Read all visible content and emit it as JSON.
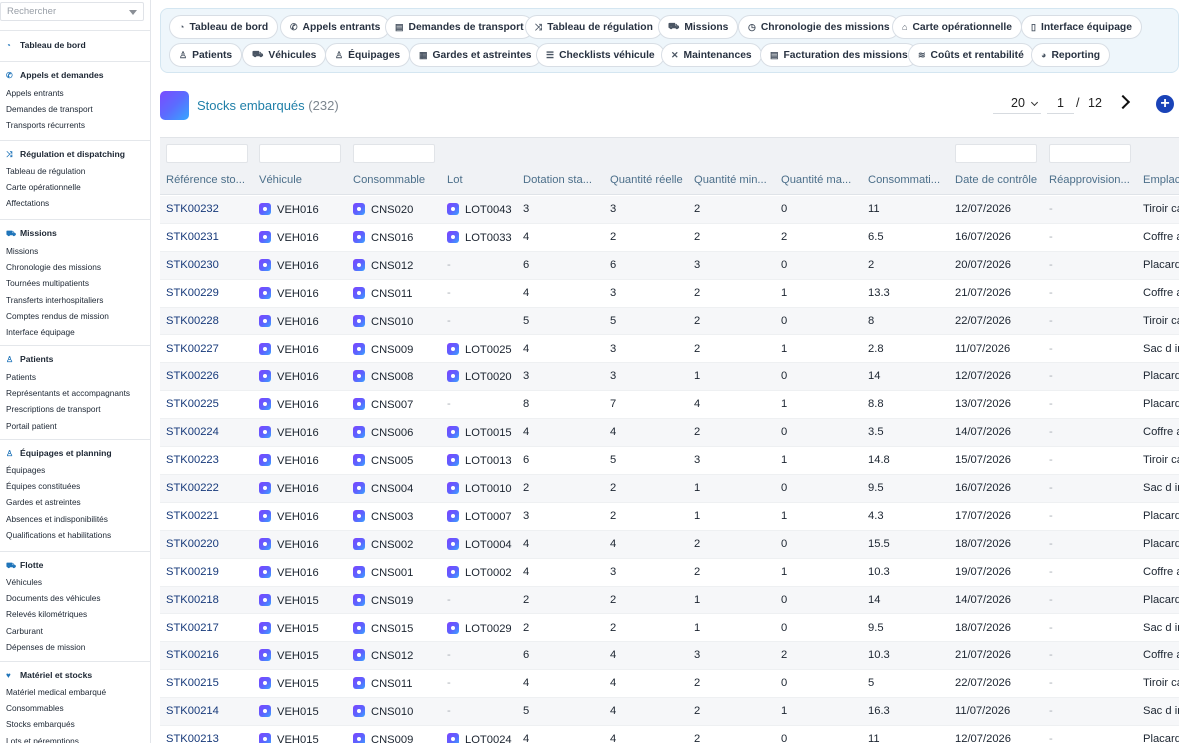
{
  "sidebar": {
    "search_placeholder": "Rechercher",
    "sections": [
      {
        "title": "Tableau de bord",
        "icon": "dashboard-icon",
        "items": []
      },
      {
        "title": "Appels et demandes",
        "icon": "phone-icon",
        "items": [
          "Appels entrants",
          "Demandes de transport",
          "Transports récurrents"
        ]
      },
      {
        "title": "Régulation et dispatching",
        "icon": "shuffle-icon",
        "items": [
          "Tableau de régulation",
          "Carte opérationnelle",
          "Affectations"
        ]
      },
      {
        "title": "Missions",
        "icon": "truck-icon",
        "items": [
          "Missions",
          "Chronologie des missions",
          "Tournées multipatients",
          "Transferts interhospitaliers",
          "Comptes rendus de mission",
          "Interface équipage"
        ]
      },
      {
        "title": "Patients",
        "icon": "person-icon",
        "items": [
          "Patients",
          "Représentants et accompagnants",
          "Prescriptions de transport",
          "Portail patient"
        ]
      },
      {
        "title": "Équipages et planning",
        "icon": "person-icon",
        "items": [
          "Équipages",
          "Équipes constituées",
          "Gardes et astreintes",
          "Absences et indisponibilités",
          "Qualifications et habilitations"
        ]
      },
      {
        "title": "Flotte",
        "icon": "truck-icon",
        "items": [
          "Véhicules",
          "Documents des véhicules",
          "Relevés kilométriques",
          "Carburant",
          "Dépenses de mission"
        ]
      },
      {
        "title": "Matériel et stocks",
        "icon": "heart-icon",
        "items": [
          "Matériel medical embarqué",
          "Consommables",
          "Stocks embarqués",
          "Lots et péremptions"
        ]
      }
    ]
  },
  "topnav": [
    {
      "label": "Tableau de bord",
      "icon": "dashboard-icon",
      "glyph": "◔"
    },
    {
      "label": "Appels entrants",
      "icon": "phone-icon",
      "glyph": "✆"
    },
    {
      "label": "Demandes de transport",
      "icon": "document-icon",
      "glyph": "▤"
    },
    {
      "label": "Tableau de régulation",
      "icon": "shuffle-icon",
      "glyph": "⤨"
    },
    {
      "label": "Missions",
      "icon": "truck-icon",
      "glyph": "⛟"
    },
    {
      "label": "Chronologie des missions",
      "icon": "stopwatch-icon",
      "glyph": "◷"
    },
    {
      "label": "Carte opérationnelle",
      "icon": "map-icon",
      "glyph": "⌂"
    },
    {
      "label": "Interface équipage",
      "icon": "mobile-icon",
      "glyph": "▯"
    },
    {
      "label": "Patients",
      "icon": "person-icon",
      "glyph": "♙"
    },
    {
      "label": "Véhicules",
      "icon": "truck-icon",
      "glyph": "⛟"
    },
    {
      "label": "Équipages",
      "icon": "person-icon",
      "glyph": "♙"
    },
    {
      "label": "Gardes et astreintes",
      "icon": "calendar-icon",
      "glyph": "▦"
    },
    {
      "label": "Checklists véhicule",
      "icon": "list-icon",
      "glyph": "☰"
    },
    {
      "label": "Maintenances",
      "icon": "tools-icon",
      "glyph": "✕"
    },
    {
      "label": "Facturation des missions",
      "icon": "invoice-icon",
      "glyph": "▤"
    },
    {
      "label": "Coûts et rentabilité",
      "icon": "coins-icon",
      "glyph": "≋"
    },
    {
      "label": "Reporting",
      "icon": "chart-icon",
      "glyph": "◕"
    }
  ],
  "header": {
    "title": "Stocks embarqués",
    "count": "(232)",
    "per_page": "20",
    "page": "1",
    "page_sep": "/",
    "total_pages": "12"
  },
  "table": {
    "columns": [
      "Référence sto...",
      "Véhicule",
      "Consommable",
      "Lot",
      "Dotation sta...",
      "Quantité réelle",
      "Quantité min...",
      "Quantité ma...",
      "Consommati...",
      "Date de contrôle",
      "Réapprovision...",
      "Emplac"
    ],
    "rows": [
      {
        "ref": "STK00232",
        "vehicle": "VEH016",
        "consumable": "CNS020",
        "lot": "LOT0043",
        "dotation": "3",
        "qty": "3",
        "min": "2",
        "max": "0",
        "conso": "11",
        "date": "12/07/2026",
        "reappro": "-",
        "place": "Tiroir ca"
      },
      {
        "ref": "STK00231",
        "vehicle": "VEH016",
        "consumable": "CNS016",
        "lot": "LOT0033",
        "dotation": "4",
        "qty": "2",
        "min": "2",
        "max": "2",
        "conso": "6.5",
        "date": "16/07/2026",
        "reappro": "-",
        "place": "Coffre a"
      },
      {
        "ref": "STK00230",
        "vehicle": "VEH016",
        "consumable": "CNS012",
        "lot": "-",
        "dotation": "6",
        "qty": "6",
        "min": "3",
        "max": "0",
        "conso": "2",
        "date": "20/07/2026",
        "reappro": "-",
        "place": "Placard"
      },
      {
        "ref": "STK00229",
        "vehicle": "VEH016",
        "consumable": "CNS011",
        "lot": "-",
        "dotation": "4",
        "qty": "3",
        "min": "2",
        "max": "1",
        "conso": "13.3",
        "date": "21/07/2026",
        "reappro": "-",
        "place": "Coffre a"
      },
      {
        "ref": "STK00228",
        "vehicle": "VEH016",
        "consumable": "CNS010",
        "lot": "-",
        "dotation": "5",
        "qty": "5",
        "min": "2",
        "max": "0",
        "conso": "8",
        "date": "22/07/2026",
        "reappro": "-",
        "place": "Tiroir ca"
      },
      {
        "ref": "STK00227",
        "vehicle": "VEH016",
        "consumable": "CNS009",
        "lot": "LOT0025",
        "dotation": "4",
        "qty": "3",
        "min": "2",
        "max": "1",
        "conso": "2.8",
        "date": "11/07/2026",
        "reappro": "-",
        "place": "Sac d ir"
      },
      {
        "ref": "STK00226",
        "vehicle": "VEH016",
        "consumable": "CNS008",
        "lot": "LOT0020",
        "dotation": "3",
        "qty": "3",
        "min": "1",
        "max": "0",
        "conso": "14",
        "date": "12/07/2026",
        "reappro": "-",
        "place": "Placard"
      },
      {
        "ref": "STK00225",
        "vehicle": "VEH016",
        "consumable": "CNS007",
        "lot": "-",
        "dotation": "8",
        "qty": "7",
        "min": "4",
        "max": "1",
        "conso": "8.8",
        "date": "13/07/2026",
        "reappro": "-",
        "place": "Placard"
      },
      {
        "ref": "STK00224",
        "vehicle": "VEH016",
        "consumable": "CNS006",
        "lot": "LOT0015",
        "dotation": "4",
        "qty": "4",
        "min": "2",
        "max": "0",
        "conso": "3.5",
        "date": "14/07/2026",
        "reappro": "-",
        "place": "Coffre a"
      },
      {
        "ref": "STK00223",
        "vehicle": "VEH016",
        "consumable": "CNS005",
        "lot": "LOT0013",
        "dotation": "6",
        "qty": "5",
        "min": "3",
        "max": "1",
        "conso": "14.8",
        "date": "15/07/2026",
        "reappro": "-",
        "place": "Tiroir ca"
      },
      {
        "ref": "STK00222",
        "vehicle": "VEH016",
        "consumable": "CNS004",
        "lot": "LOT0010",
        "dotation": "2",
        "qty": "2",
        "min": "1",
        "max": "0",
        "conso": "9.5",
        "date": "16/07/2026",
        "reappro": "-",
        "place": "Sac d ir"
      },
      {
        "ref": "STK00221",
        "vehicle": "VEH016",
        "consumable": "CNS003",
        "lot": "LOT0007",
        "dotation": "3",
        "qty": "2",
        "min": "1",
        "max": "1",
        "conso": "4.3",
        "date": "17/07/2026",
        "reappro": "-",
        "place": "Placard"
      },
      {
        "ref": "STK00220",
        "vehicle": "VEH016",
        "consumable": "CNS002",
        "lot": "LOT0004",
        "dotation": "4",
        "qty": "4",
        "min": "2",
        "max": "0",
        "conso": "15.5",
        "date": "18/07/2026",
        "reappro": "-",
        "place": "Placard"
      },
      {
        "ref": "STK00219",
        "vehicle": "VEH016",
        "consumable": "CNS001",
        "lot": "LOT0002",
        "dotation": "4",
        "qty": "3",
        "min": "2",
        "max": "1",
        "conso": "10.3",
        "date": "19/07/2026",
        "reappro": "-",
        "place": "Coffre a"
      },
      {
        "ref": "STK00218",
        "vehicle": "VEH015",
        "consumable": "CNS019",
        "lot": "-",
        "dotation": "2",
        "qty": "2",
        "min": "1",
        "max": "0",
        "conso": "14",
        "date": "14/07/2026",
        "reappro": "-",
        "place": "Placard"
      },
      {
        "ref": "STK00217",
        "vehicle": "VEH015",
        "consumable": "CNS015",
        "lot": "LOT0029",
        "dotation": "2",
        "qty": "2",
        "min": "1",
        "max": "0",
        "conso": "9.5",
        "date": "18/07/2026",
        "reappro": "-",
        "place": "Sac d ir"
      },
      {
        "ref": "STK00216",
        "vehicle": "VEH015",
        "consumable": "CNS012",
        "lot": "-",
        "dotation": "6",
        "qty": "4",
        "min": "3",
        "max": "2",
        "conso": "10.3",
        "date": "21/07/2026",
        "reappro": "-",
        "place": "Coffre a"
      },
      {
        "ref": "STK00215",
        "vehicle": "VEH015",
        "consumable": "CNS011",
        "lot": "-",
        "dotation": "4",
        "qty": "4",
        "min": "2",
        "max": "0",
        "conso": "5",
        "date": "22/07/2026",
        "reappro": "-",
        "place": "Tiroir ca"
      },
      {
        "ref": "STK00214",
        "vehicle": "VEH015",
        "consumable": "CNS010",
        "lot": "-",
        "dotation": "5",
        "qty": "4",
        "min": "2",
        "max": "1",
        "conso": "16.3",
        "date": "11/07/2026",
        "reappro": "-",
        "place": "Sac d ir"
      },
      {
        "ref": "STK00213",
        "vehicle": "VEH015",
        "consumable": "CNS009",
        "lot": "LOT0024",
        "dotation": "4",
        "qty": "4",
        "min": "2",
        "max": "0",
        "conso": "11",
        "date": "12/07/2026",
        "reappro": "-",
        "place": "Placard"
      }
    ]
  },
  "colors": {
    "accent": "#1f7fa8",
    "link": "#16397a",
    "nav_bg": "#eef6fb",
    "add_button": "#1a43b8"
  }
}
